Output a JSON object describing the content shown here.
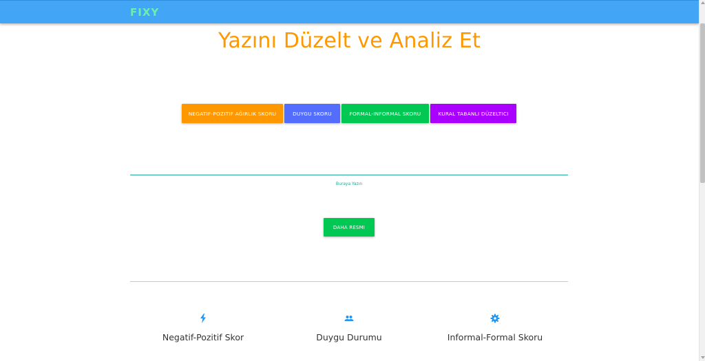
{
  "navbar": {
    "brand": "FIXY",
    "brand_color": "#69f0ae",
    "background": "#42a5f5"
  },
  "main": {
    "title": "Yazını Düzelt ve Analiz Et",
    "buttons": [
      {
        "label": "NEGATIF-POZITIF AĞIRLIK SKORU",
        "color": "#ff9800"
      },
      {
        "label": "DUYGU SKORU",
        "color": "#536dfe"
      },
      {
        "label": "FORMAL-INFORMAL SKORU",
        "color": "#00c853"
      },
      {
        "label": "KURAL TABANLI DÜZELTICI",
        "color": "#aa00ff"
      }
    ],
    "text_input": {
      "value": "",
      "label": "Buraya Yazın"
    },
    "action_button": {
      "label": "DAHA RESMI",
      "color": "#00c853"
    }
  },
  "features": [
    {
      "icon": "flash-icon",
      "label": "Negatif-Pozitif Skor"
    },
    {
      "icon": "people-icon",
      "label": "Duygu Durumu"
    },
    {
      "icon": "gear-icon",
      "label": "Informal-Formal Skoru"
    }
  ]
}
